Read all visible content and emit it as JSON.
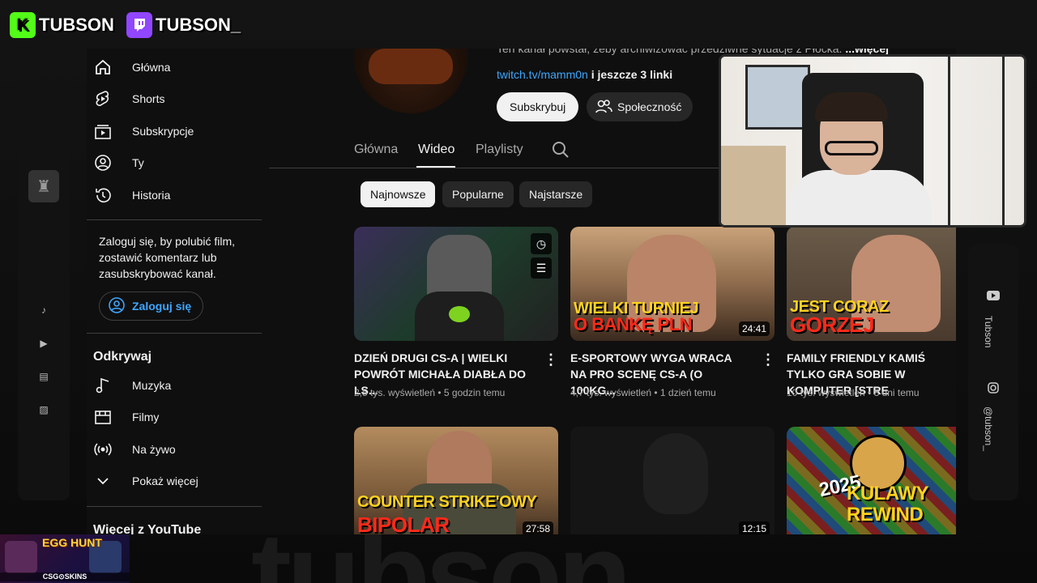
{
  "overlay": {
    "kick_name": "TUBSON",
    "twitch_name": "TUBSON_",
    "watermark": "tubson",
    "right_rail": {
      "youtube_label": "Tubson",
      "instagram_label": "@tubson_"
    }
  },
  "sidebar": {
    "items": [
      {
        "label": "Główna",
        "icon": "home-icon"
      },
      {
        "label": "Shorts",
        "icon": "shorts-icon"
      },
      {
        "label": "Subskrypcje",
        "icon": "subscriptions-icon"
      },
      {
        "label": "Ty",
        "icon": "account-icon"
      },
      {
        "label": "Historia",
        "icon": "history-icon"
      }
    ],
    "login_prompt": "Zaloguj się, by polubić film, zostawić komentarz lub zasubskrybować kanał.",
    "login_button": "Zaloguj się",
    "explore_heading": "Odkrywaj",
    "explore_items": [
      {
        "label": "Muzyka",
        "icon": "music-icon"
      },
      {
        "label": "Filmy",
        "icon": "film-icon"
      },
      {
        "label": "Na żywo",
        "icon": "live-icon"
      },
      {
        "label": "Pokaż więcej",
        "icon": "chevron-down-icon"
      }
    ],
    "more_heading": "Więcej z YouTube"
  },
  "channel": {
    "description": "Ten kanał powstał, żeby archiwizować przedziwne sytuacje z Płocka.",
    "description_more": "...więcej",
    "link": "twitch.tv/mamm0n",
    "link_suffix": "i jeszcze 3 linki",
    "subscribe": "Subskrybuj",
    "community": "Społeczność"
  },
  "tabs": [
    {
      "label": "Główna",
      "active": false
    },
    {
      "label": "Wideo",
      "active": true
    },
    {
      "label": "Playlisty",
      "active": false
    }
  ],
  "chips": [
    {
      "label": "Najnowsze",
      "active": true
    },
    {
      "label": "Popularne",
      "active": false
    },
    {
      "label": "Najstarsze",
      "active": false
    }
  ],
  "videos": [
    {
      "title": "DZIEŃ DRUGI CS-a | WIELKI POWRÓT MICHAŁA DIABŁA DO LS...",
      "meta": "2,5 tys. wyświetleń • 5 godzin temu",
      "duration": "",
      "cap1": "",
      "cap2": ""
    },
    {
      "title": "E-SPORTOWY WYGA WRACA NA PRO SCENĘ CS-a (O 100KG...",
      "meta": "4,7 tys. wyświetleń • 1 dzień temu",
      "duration": "24:41",
      "cap1": "WIELKI TURNIEJ",
      "cap2": "O BANKĘ PLN"
    },
    {
      "title": "FAMILY FRIENDLY KAMIŚ TYLKO GRA SOBIE W KOMPUTER [STRE",
      "meta": "10 tys. wyświetleń • 8 dni temu",
      "duration": "",
      "cap1": "JEST CORAZ",
      "cap2": "GORZEJ"
    },
    {
      "duration": "27:58",
      "cap1": "COUNTER STRIKE'OWY",
      "cap2": "BIPOLAR"
    },
    {
      "duration": "12:15"
    },
    {
      "duration": "",
      "cap1": "2025",
      "cap2": "KULAWY REWIND"
    }
  ],
  "promo": {
    "title": "EGG HUNT",
    "brand": "CSG⊙SKINS"
  }
}
